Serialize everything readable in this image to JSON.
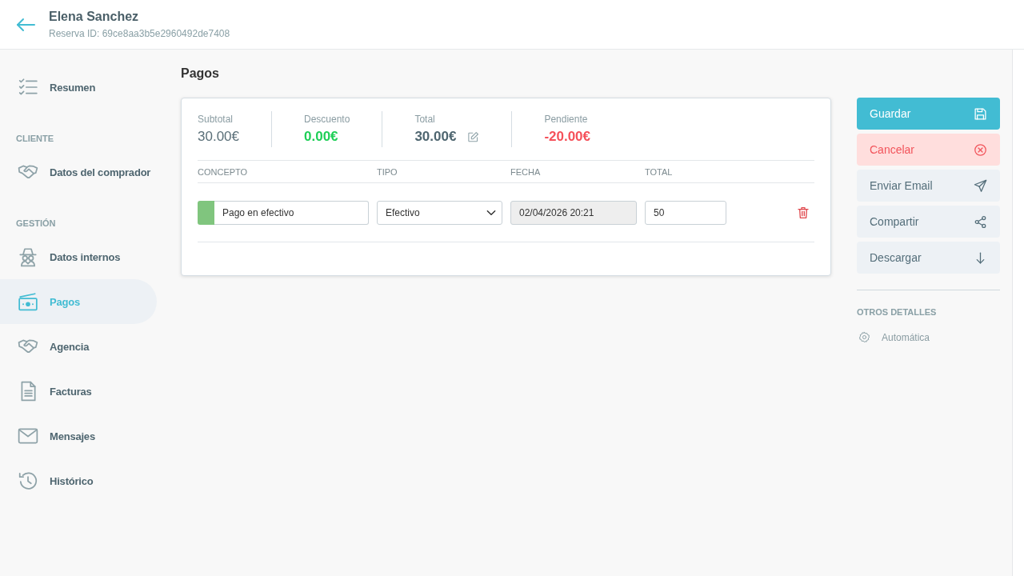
{
  "header": {
    "title": "Elena Sanchez",
    "subtitle": "Reserva ID: 69ce8aa3b5e2960492de7408"
  },
  "sidebar": {
    "sections": [
      {
        "items": [
          {
            "label": "Resumen",
            "selected": false
          }
        ]
      },
      {
        "heading": "CLIENTE",
        "items": [
          {
            "label": "Datos del comprador",
            "selected": false
          }
        ]
      },
      {
        "heading": "GESTIÓN",
        "items": [
          {
            "label": "Datos internos",
            "selected": false
          },
          {
            "label": "Pagos",
            "selected": true
          },
          {
            "label": "Agencia",
            "selected": false
          },
          {
            "label": "Facturas",
            "selected": false
          },
          {
            "label": "Mensajes",
            "selected": false
          },
          {
            "label": "Histórico",
            "selected": false
          }
        ]
      }
    ]
  },
  "payments": {
    "title": "Pagos",
    "summary": [
      {
        "label": "Subtotal",
        "value": "30.00€",
        "kind": "plain"
      },
      {
        "label": "Descuento",
        "value": "0.00€",
        "kind": "positive"
      },
      {
        "label": "Total",
        "value": "30.00€",
        "kind": "editable"
      },
      {
        "label": "Pendiente",
        "value": "-20.00€",
        "kind": "negative"
      }
    ],
    "table": {
      "columns": [
        "CONCEPTO",
        "TIPO",
        "FECHA",
        "TOTAL"
      ],
      "rows": [
        {
          "concept": "Pago en efectivo",
          "color": "#80c57e",
          "type": "Efectivo",
          "date": "02/04/2026 20:21",
          "date_disabled": true,
          "total": "50"
        }
      ]
    }
  },
  "actions": [
    {
      "label": "Guardar",
      "kind": "primary"
    },
    {
      "label": "Cancelar",
      "kind": "danger"
    },
    {
      "label": "Enviar Email",
      "kind": "default"
    },
    {
      "label": "Compartir",
      "kind": "default"
    },
    {
      "label": "Descargar",
      "kind": "default"
    }
  ],
  "details": {
    "heading": "OTROS DETALLES",
    "items": [
      {
        "label": "Automática"
      }
    ]
  }
}
